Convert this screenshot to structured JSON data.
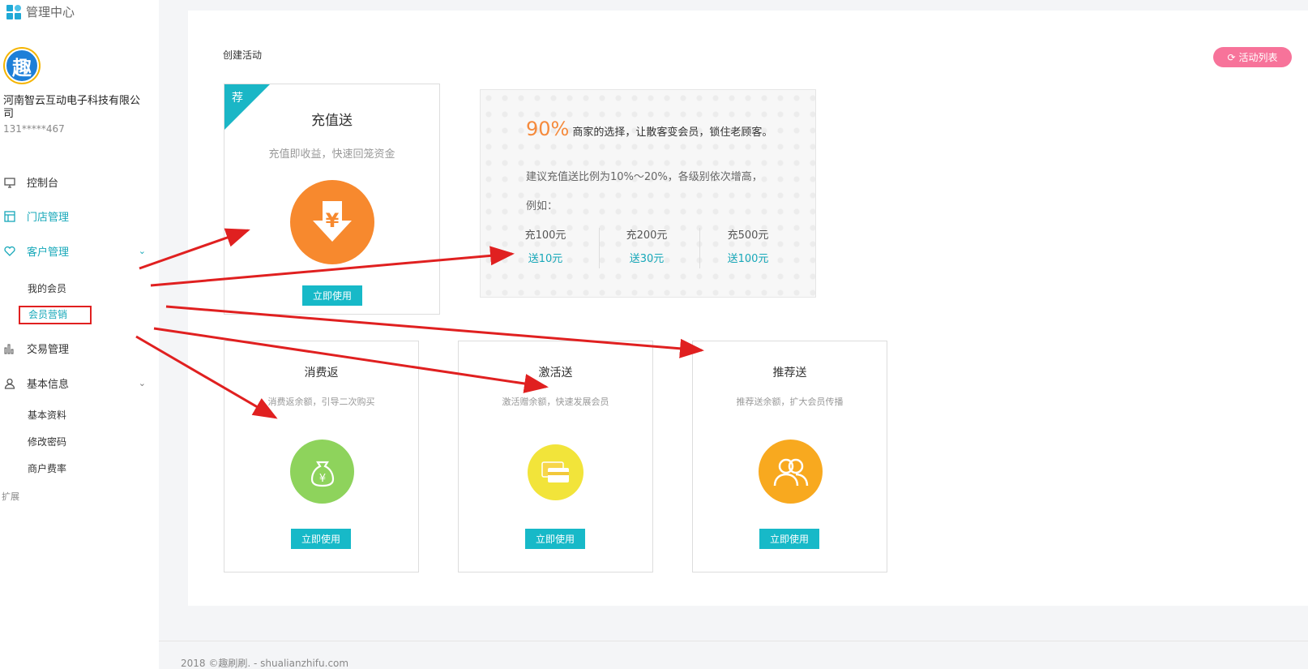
{
  "sidebar": {
    "brand_title": "管理中心",
    "avatar_char": "趣",
    "company": "河南智云互动电子科技有限公司",
    "phone": "131*****467",
    "nav": {
      "console": "控制台",
      "store": "门店管理",
      "customer": "客户管理",
      "my_members": "我的会员",
      "member_marketing": "会员营销",
      "trade": "交易管理",
      "basic_info": "基本信息",
      "basic_profile": "基本资料",
      "change_password": "修改密码",
      "merchant_rate": "商户费率",
      "extension": "扩展"
    }
  },
  "main": {
    "page_title": "创建活动",
    "list_button": "活动列表",
    "use_label": "立即使用",
    "recharge": {
      "badge": "荐",
      "title": "充值送",
      "desc": "充值即收益，快速回笼资金"
    },
    "info": {
      "percent": "90%",
      "percent_text": "商家的选择，让散客变会员，锁住老顾客。",
      "tip1": "建议充值送比例为10%～20%，各级别依次增高，",
      "tip2": "例如：",
      "examples": [
        {
          "charge": "充100元",
          "bonus": "送10元"
        },
        {
          "charge": "充200元",
          "bonus": "送30元"
        },
        {
          "charge": "充500元",
          "bonus": "送100元"
        }
      ]
    },
    "cards": [
      {
        "title": "消费返",
        "desc": "消费返余额，引导二次购买"
      },
      {
        "title": "激活送",
        "desc": "激活赠余额，快速发展会员"
      },
      {
        "title": "推荐送",
        "desc": "推荐送余额，扩大会员传播"
      }
    ]
  },
  "footer": "2018 ©趣刷刷. - shualianzhifu.com",
  "colors": {
    "accent": "#17a8b9",
    "button": "#17b9c8",
    "pink": "#f7739a",
    "orange": "#f58a3c",
    "green": "#8ed35c",
    "yellow": "#f2e43a",
    "amber": "#f8a91f",
    "annotation_red": "#e02020"
  },
  "icons": [
    "grid-icon",
    "monitor-icon",
    "store-icon",
    "heart-icon",
    "chevron-down-icon",
    "bar-chart-icon",
    "user-icon",
    "yen-arrow-icon",
    "money-bag-icon",
    "card-icon",
    "users-icon",
    "refresh-icon"
  ]
}
